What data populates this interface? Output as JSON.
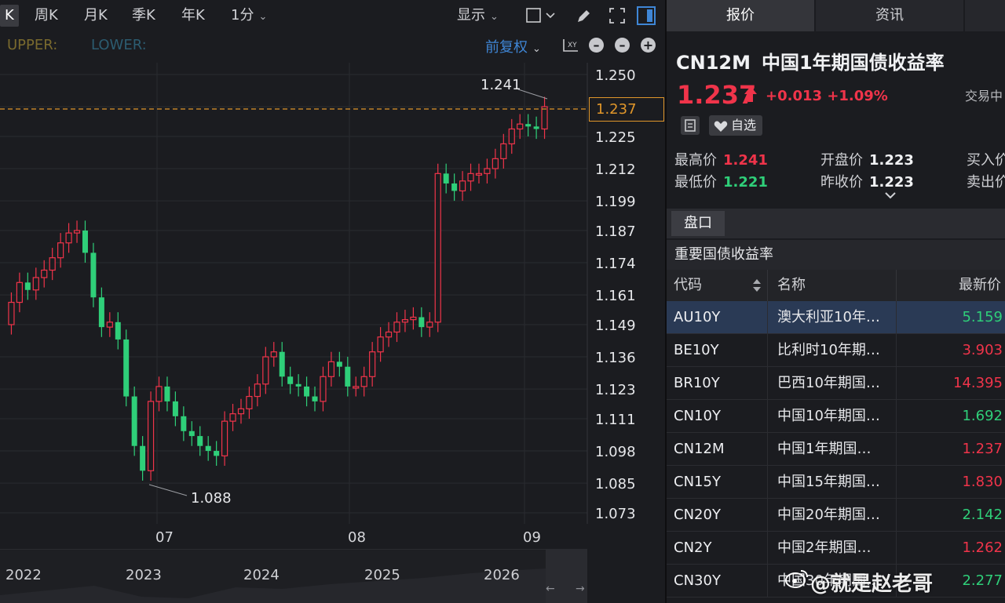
{
  "toolbar": {
    "periods": [
      "K",
      "周K",
      "月K",
      "季K",
      "年K"
    ],
    "interval": "1分",
    "display_label": "显示"
  },
  "indicators": {
    "upper": "UPPER:",
    "lower": "LOWER:"
  },
  "adjust_label": "前复权",
  "icons": {
    "draw": "pen-icon",
    "fullscreen": "expand-icon",
    "layout": "sidebar-layout-icon",
    "zoom_out": "minus-icon",
    "zoom_in": "plus-icon",
    "settings": "axis-settings-icon"
  },
  "chart": {
    "price_axis": [
      "1.250",
      "1.237",
      "1.225",
      "1.212",
      "1.199",
      "1.187",
      "1.174",
      "1.161",
      "1.149",
      "1.136",
      "1.123",
      "1.111",
      "1.098",
      "1.085",
      "1.073"
    ],
    "current_price_box": "1.237",
    "high_annotation": "1.241",
    "low_annotation": "1.088",
    "x_labels": [
      "07",
      "08",
      "09"
    ],
    "navigator_years": [
      "2022",
      "2023",
      "2024",
      "2025",
      "2026"
    ],
    "colors": {
      "up": "#f0344a",
      "down": "#2fcf79",
      "current_line": "#e0962a"
    }
  },
  "tabs": [
    "报价",
    "资讯"
  ],
  "quote": {
    "code": "CN12M",
    "name": "中国1年期国债收益率",
    "last": "1.237",
    "change": "+0.013",
    "change_pct": "+1.09%",
    "status": "交易中",
    "watch_label": "自选",
    "high_label": "最高价",
    "high": "1.241",
    "low_label": "最低价",
    "low": "1.221",
    "open_label": "开盘价",
    "open": "1.223",
    "prev_label": "昨收价",
    "prev": "1.223",
    "bid_label": "买入价",
    "ask_label": "卖出价"
  },
  "pankou_label": "盘口",
  "section_title": "重要国债收益率",
  "table": {
    "headers": {
      "code": "代码",
      "name": "名称",
      "price": "最新价"
    },
    "rows": [
      {
        "code": "AU10Y",
        "name": "澳大利亚10年…",
        "price": "5.159",
        "dir": "green"
      },
      {
        "code": "BE10Y",
        "name": "比利时10年期…",
        "price": "3.903",
        "dir": "red"
      },
      {
        "code": "BR10Y",
        "name": "巴西10年期国…",
        "price": "14.395",
        "dir": "red"
      },
      {
        "code": "CN10Y",
        "name": "中国10年期国…",
        "price": "1.692",
        "dir": "green"
      },
      {
        "code": "CN12M",
        "name": "中国1年期国…",
        "price": "1.237",
        "dir": "red"
      },
      {
        "code": "CN15Y",
        "name": "中国15年期国…",
        "price": "1.830",
        "dir": "red"
      },
      {
        "code": "CN20Y",
        "name": "中国20年期国…",
        "price": "2.142",
        "dir": "green"
      },
      {
        "code": "CN2Y",
        "name": "中国2年期国…",
        "price": "1.262",
        "dir": "red"
      },
      {
        "code": "CN30Y",
        "name": "中国30年期国…",
        "price": "2.277",
        "dir": "green"
      }
    ]
  },
  "watermark": "@就是赵老哥"
}
